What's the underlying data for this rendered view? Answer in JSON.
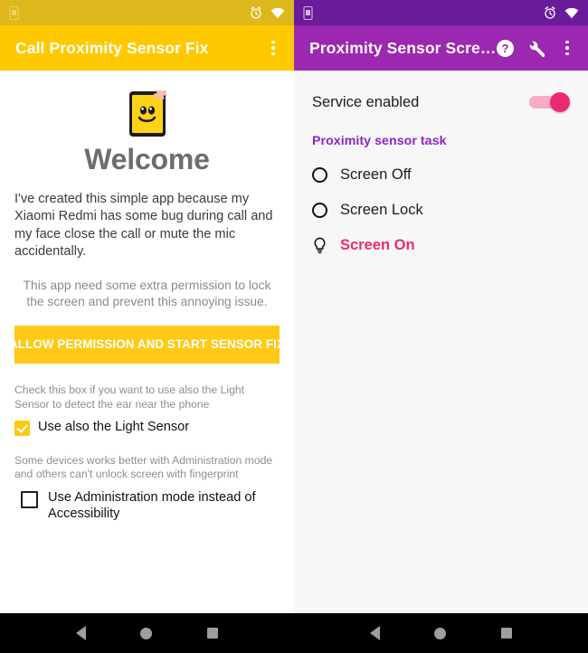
{
  "left": {
    "statusbar": {
      "notification_icon": "phone-notification-icon",
      "alarm_icon": "alarm-clock-icon",
      "wifi_icon": "wifi-icon"
    },
    "appbar": {
      "title": "Call Proximity Sensor Fix",
      "overflow_icon": "overflow-menu-icon"
    },
    "logo_icon": "app-logo-phone-smiley-icon",
    "heading": "Welcome",
    "intro": "I've created this simple app because my Xiaomi Redmi has some bug during call and my face close the call or mute the mic accidentally.",
    "permission_text": "This app need some extra permission to lock the screen and prevent this annoying issue.",
    "allow_button": "ALLOW PERMISSION AND START SENSOR FIX",
    "light_sensor_hint": "Check this box if you want to use also the Light Sensor to detect the ear near the phone",
    "light_sensor_label": "Use also the Light Sensor",
    "light_sensor_checked": true,
    "admin_hint": "Some devices works better with Administration mode and others can't unlock screen with fingerprint",
    "admin_label": "Use Administration mode instead of Accessibility",
    "admin_checked": false
  },
  "right": {
    "statusbar": {
      "notification_icon": "phone-notification-icon",
      "alarm_icon": "alarm-clock-icon",
      "wifi_icon": "wifi-icon"
    },
    "appbar": {
      "title": "Proximity Sensor Scre…",
      "help_icon": "help-circle-icon",
      "wrench_icon": "wrench-icon",
      "overflow_icon": "overflow-menu-icon"
    },
    "service_label": "Service enabled",
    "service_enabled": true,
    "section_title": "Proximity sensor task",
    "options": [
      {
        "label": "Screen Off",
        "selected": false,
        "icon": "radio-unselected-icon"
      },
      {
        "label": "Screen Lock",
        "selected": false,
        "icon": "radio-unselected-icon"
      },
      {
        "label": "Screen On",
        "selected": true,
        "icon": "lightbulb-icon"
      }
    ]
  },
  "navbar": {
    "back_icon": "back-triangle-icon",
    "home_icon": "home-circle-icon",
    "recents_icon": "recents-square-icon"
  },
  "colors": {
    "left_accent": "#ffc900",
    "left_status": "#dcb81c",
    "right_accent": "#9c27b0",
    "right_status": "#6a1b9a",
    "pink": "#ec2a72",
    "purple_text": "#8e24c4"
  }
}
